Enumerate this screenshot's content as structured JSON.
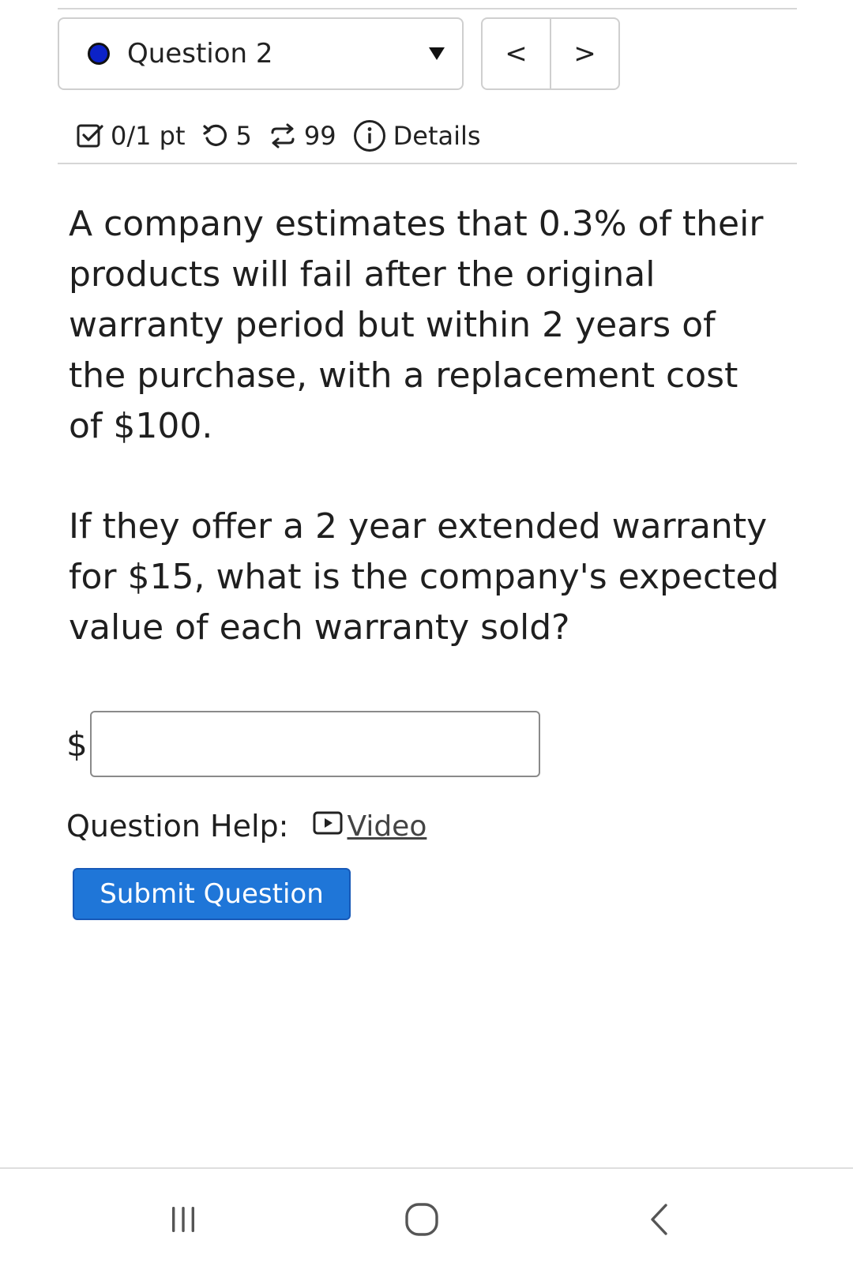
{
  "question_nav": {
    "selected_question": "Question 2",
    "prev_label": "<",
    "next_label": ">",
    "status_color": "#0c22c8"
  },
  "meta": {
    "points": "0/1 pt",
    "attempts": "5",
    "regenerations": "99",
    "details_label": "Details"
  },
  "question": {
    "paragraph_1": "A company estimates that 0.3% of their products will fail after the original warranty period but within 2 years of the purchase, with a replacement cost of $100.",
    "paragraph_2": "If they offer a 2 year extended warranty for $15, what is the company's expected value of each warranty sold?"
  },
  "answer": {
    "currency_symbol": "$",
    "value": ""
  },
  "help": {
    "label": "Question Help:",
    "video_label": "Video"
  },
  "submit": {
    "label": "Submit Question",
    "color": "#1f76d8"
  },
  "system_nav": {
    "icons": [
      "recents-icon",
      "home-icon",
      "back-icon"
    ]
  }
}
